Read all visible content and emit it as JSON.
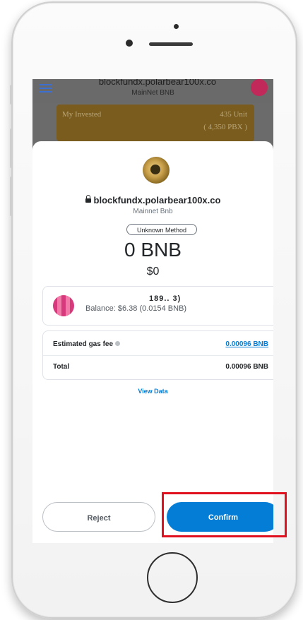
{
  "dapp": {
    "url": "blockfundx.polarbear100x.co",
    "network": "MainNet BNB",
    "card_label": "My Invested",
    "card_units": "435 Unit",
    "card_pbx": "( 4,350 PBX )"
  },
  "modal": {
    "origin": "blockfundx.polarbear100x.co",
    "network": "Mainnet Bnb",
    "method": "Unknown Method",
    "amount": "0 BNB",
    "fiat": "$0",
    "account": {
      "name_partial": "189..   3)",
      "balance": "Balance: $6.38 (0.0154 BNB)"
    },
    "fees": {
      "gas_label": "Estimated gas fee",
      "gas_value": "0.00096 BNB",
      "total_label": "Total",
      "total_value": "0.00096 BNB"
    },
    "view_data": "View Data",
    "reject_label": "Reject",
    "confirm_label": "Confirm"
  },
  "colors": {
    "accent": "#037dd6",
    "highlight": "#e0101e"
  }
}
